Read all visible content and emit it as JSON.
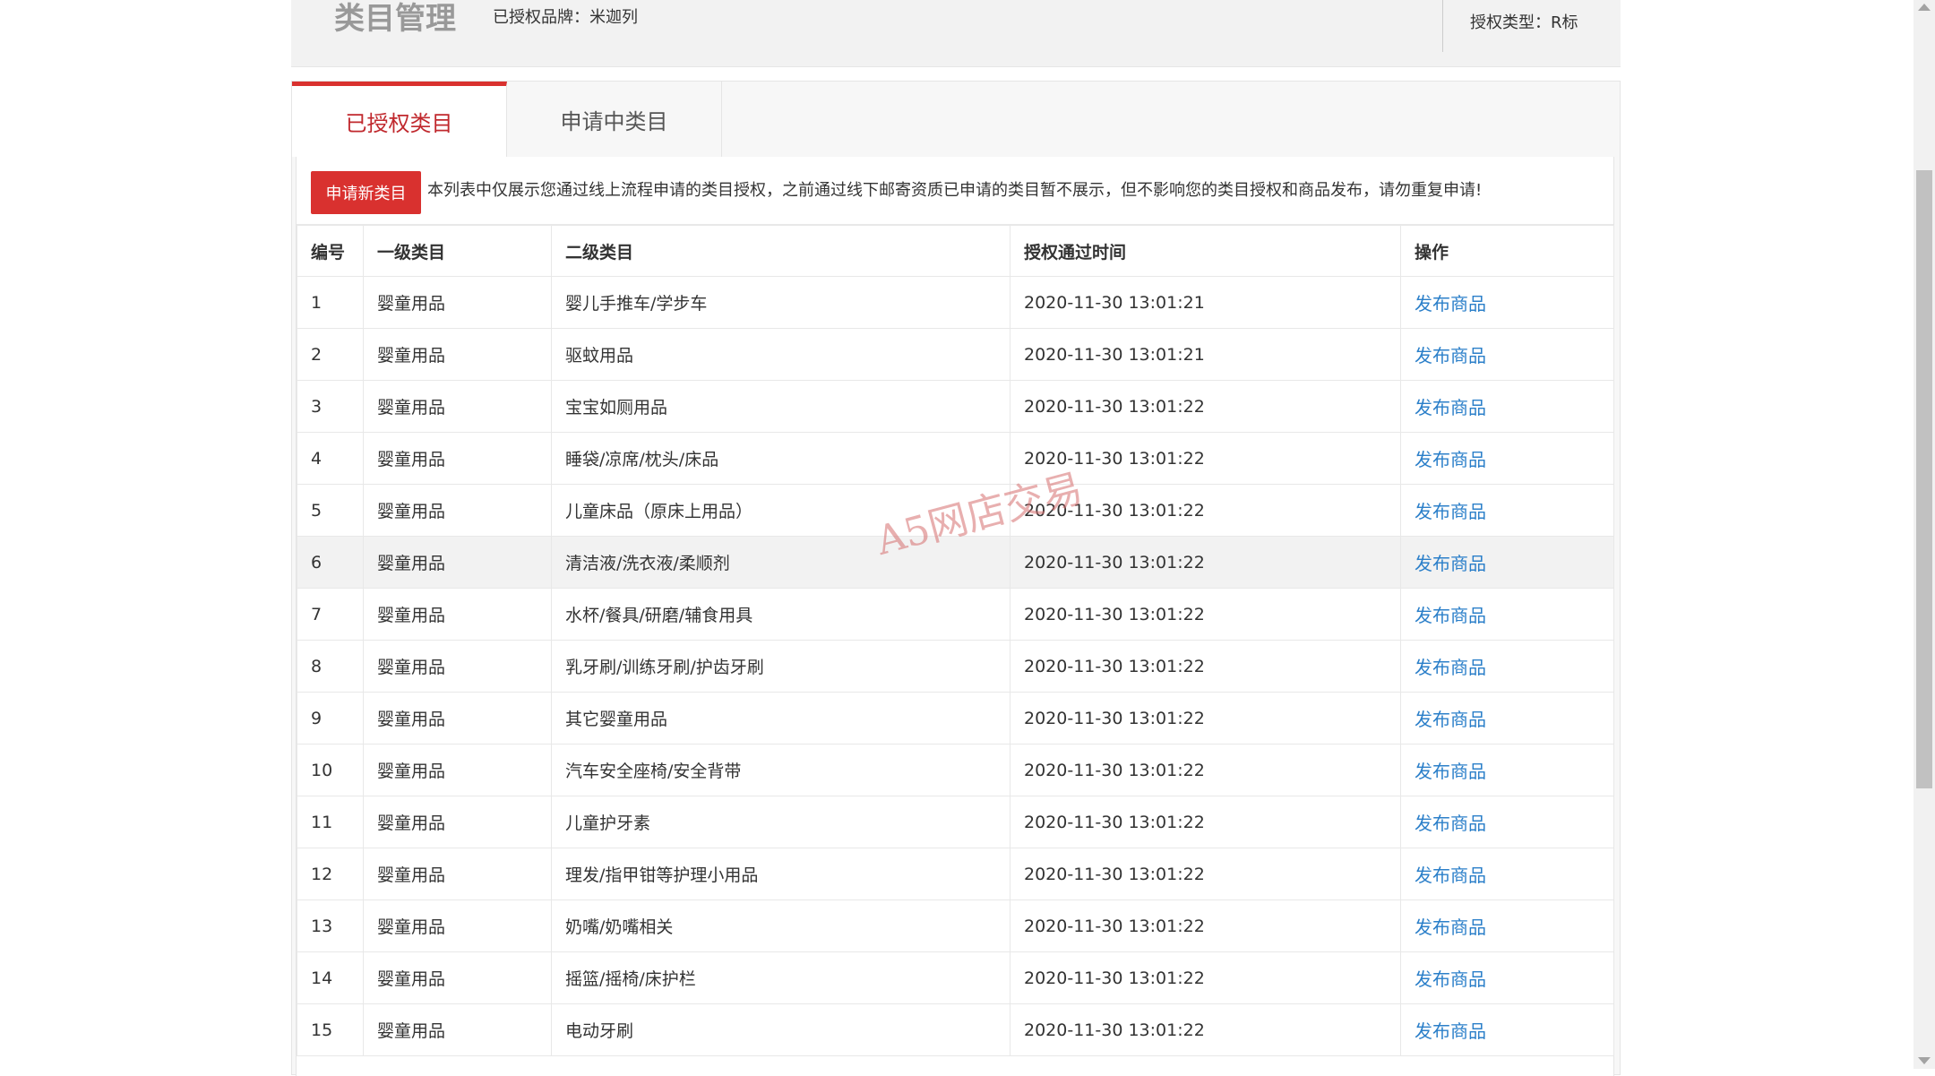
{
  "header": {
    "title": "类目管理",
    "brand": "已授权品牌：米迦列",
    "auth_type": "授权类型：R标"
  },
  "tabs": [
    {
      "label": "已授权类目",
      "active": true
    },
    {
      "label": "申请中类目",
      "active": false
    }
  ],
  "toolbar": {
    "apply_label": "申请新类目",
    "notice": "本列表中仅展示您通过线上流程申请的类目授权，之前通过线下邮寄资质已申请的类目暂不展示，但不影响您的类目授权和商品发布，请勿重复申请!"
  },
  "table": {
    "columns": [
      "编号",
      "一级类目",
      "二级类目",
      "授权通过时间",
      "操作"
    ],
    "rows": [
      {
        "id": "1",
        "level1": "婴童用品",
        "level2": "婴儿手推车/学步车",
        "time": "2020-11-30 13:01:21",
        "action": "发布商品"
      },
      {
        "id": "2",
        "level1": "婴童用品",
        "level2": "驱蚊用品",
        "time": "2020-11-30 13:01:21",
        "action": "发布商品"
      },
      {
        "id": "3",
        "level1": "婴童用品",
        "level2": "宝宝如厕用品",
        "time": "2020-11-30 13:01:22",
        "action": "发布商品"
      },
      {
        "id": "4",
        "level1": "婴童用品",
        "level2": "睡袋/凉席/枕头/床品",
        "time": "2020-11-30 13:01:22",
        "action": "发布商品"
      },
      {
        "id": "5",
        "level1": "婴童用品",
        "level2": "儿童床品（原床上用品）",
        "time": "2020-11-30 13:01:22",
        "action": "发布商品"
      },
      {
        "id": "6",
        "level1": "婴童用品",
        "level2": "清洁液/洗衣液/柔顺剂",
        "time": "2020-11-30 13:01:22",
        "action": "发布商品"
      },
      {
        "id": "7",
        "level1": "婴童用品",
        "level2": "水杯/餐具/研磨/辅食用具",
        "time": "2020-11-30 13:01:22",
        "action": "发布商品"
      },
      {
        "id": "8",
        "level1": "婴童用品",
        "level2": "乳牙刷/训练牙刷/护齿牙刷",
        "time": "2020-11-30 13:01:22",
        "action": "发布商品"
      },
      {
        "id": "9",
        "level1": "婴童用品",
        "level2": "其它婴童用品",
        "time": "2020-11-30 13:01:22",
        "action": "发布商品"
      },
      {
        "id": "10",
        "level1": "婴童用品",
        "level2": "汽车安全座椅/安全背带",
        "time": "2020-11-30 13:01:22",
        "action": "发布商品"
      },
      {
        "id": "11",
        "level1": "婴童用品",
        "level2": "儿童护牙素",
        "time": "2020-11-30 13:01:22",
        "action": "发布商品"
      },
      {
        "id": "12",
        "level1": "婴童用品",
        "level2": "理发/指甲钳等护理小用品",
        "time": "2020-11-30 13:01:22",
        "action": "发布商品"
      },
      {
        "id": "13",
        "level1": "婴童用品",
        "level2": "奶嘴/奶嘴相关",
        "time": "2020-11-30 13:01:22",
        "action": "发布商品"
      },
      {
        "id": "14",
        "level1": "婴童用品",
        "level2": "摇篮/摇椅/床护栏",
        "time": "2020-11-30 13:01:22",
        "action": "发布商品"
      },
      {
        "id": "15",
        "level1": "婴童用品",
        "level2": "电动牙刷",
        "time": "2020-11-30 13:01:22",
        "action": "发布商品"
      }
    ]
  },
  "watermark": "A5网店交易",
  "colors": {
    "accent": "#d9312f",
    "link": "#2b7fc9"
  }
}
